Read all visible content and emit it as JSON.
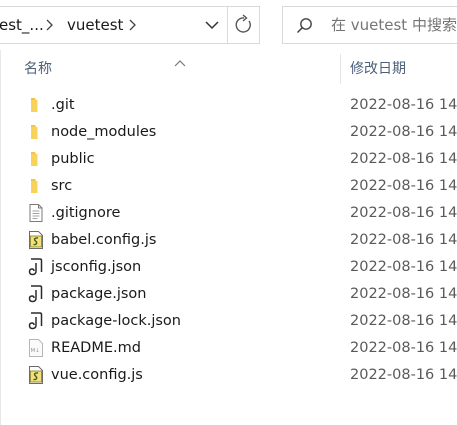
{
  "address": {
    "crumbs": [
      "est_...",
      "vuetest"
    ]
  },
  "search": {
    "placeholder": "在 vuetest 中搜索"
  },
  "columns": {
    "name": "名称",
    "date": "修改日期"
  },
  "files": [
    {
      "name": ".git",
      "date": "2022-08-16 14",
      "type": "folder"
    },
    {
      "name": "node_modules",
      "date": "2022-08-16 14",
      "type": "folder"
    },
    {
      "name": "public",
      "date": "2022-08-16 14",
      "type": "folder"
    },
    {
      "name": "src",
      "date": "2022-08-16 14",
      "type": "folder"
    },
    {
      "name": ".gitignore",
      "date": "2022-08-16 14",
      "type": "text"
    },
    {
      "name": "babel.config.js",
      "date": "2022-08-16 14",
      "type": "js"
    },
    {
      "name": "jsconfig.json",
      "date": "2022-08-16 14",
      "type": "json"
    },
    {
      "name": "package.json",
      "date": "2022-08-16 14",
      "type": "json"
    },
    {
      "name": "package-lock.json",
      "date": "2022-08-16 14",
      "type": "json"
    },
    {
      "name": "README.md",
      "date": "2022-08-16 14",
      "type": "md"
    },
    {
      "name": "vue.config.js",
      "date": "2022-08-16 14",
      "type": "js"
    }
  ],
  "colors": {
    "folder": "#f4c542",
    "header_text": "#4c607a",
    "border": "#d9d9d9"
  },
  "icons": {
    "folder": "folder-icon",
    "text": "text-file-icon",
    "js": "js-file-icon",
    "json": "json-file-icon",
    "md": "markdown-file-icon"
  }
}
